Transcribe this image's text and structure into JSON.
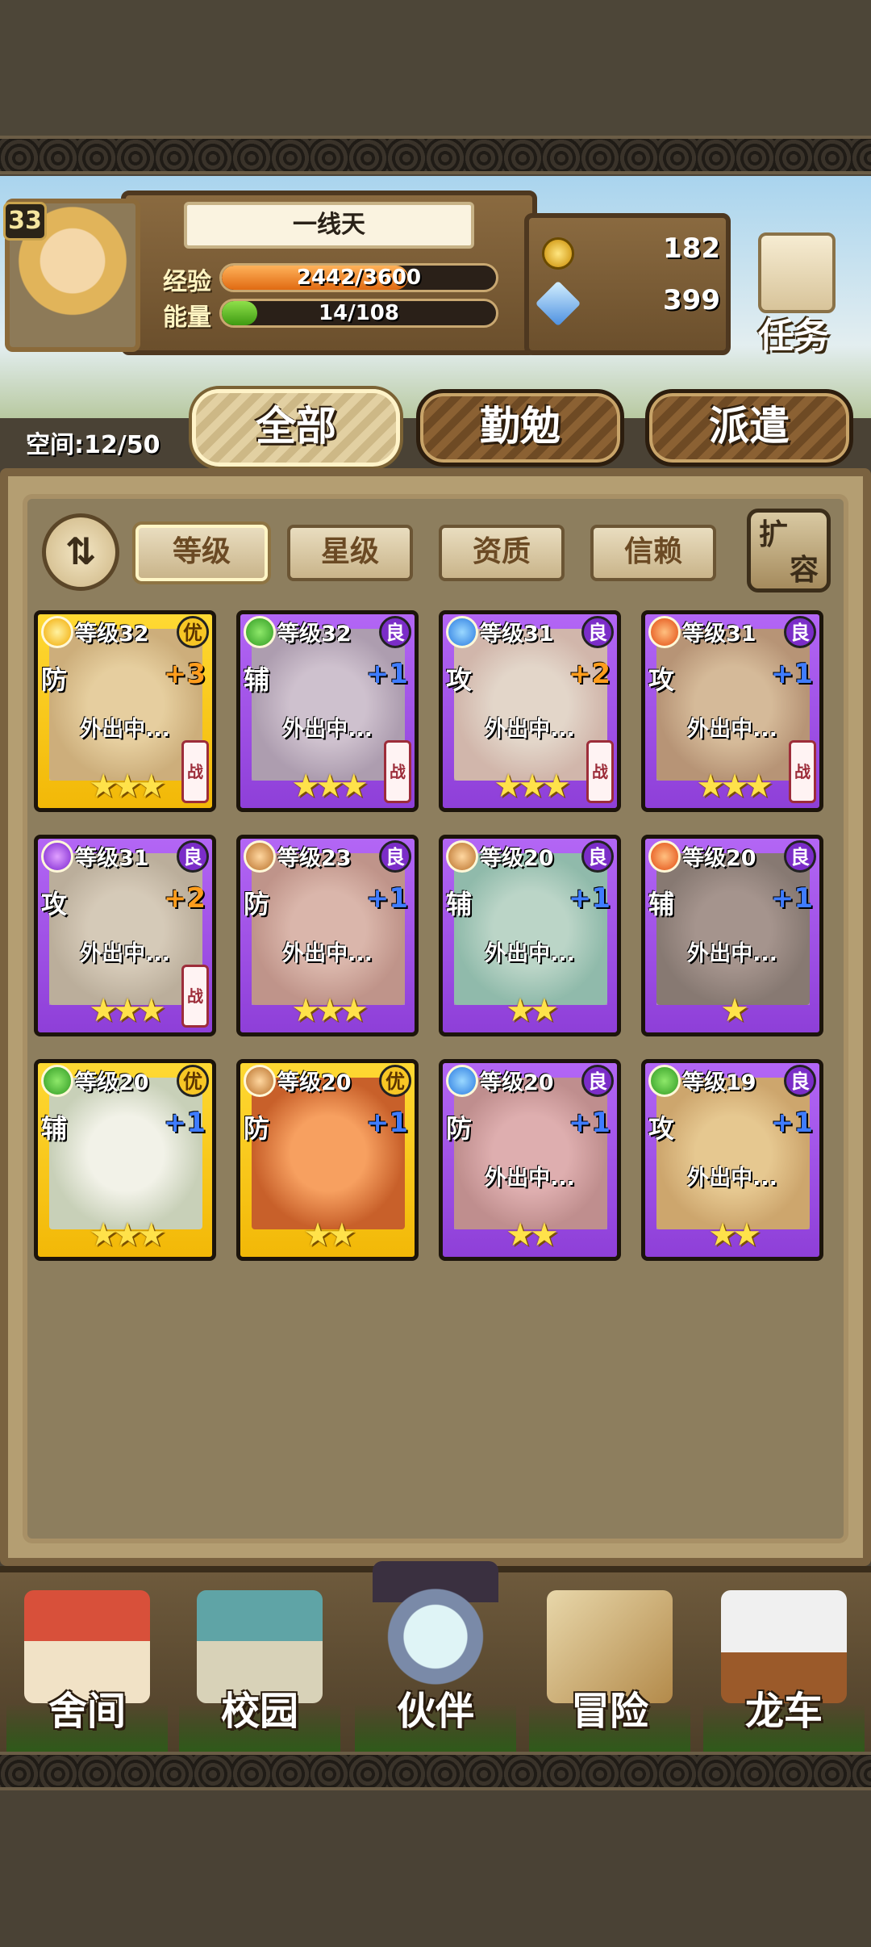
{
  "player": {
    "level": "33",
    "name": "一线天",
    "exp_label": "经验",
    "exp_text": "2442/3600",
    "exp_fraction": 0.678,
    "energy_label": "能量",
    "energy_text": "14/108",
    "energy_fraction": 0.13,
    "gold": "182",
    "gems": "399"
  },
  "task_label": "任务",
  "space_text": "空间:12/50",
  "tabs": {
    "all": "全部",
    "diligent": "勤勉",
    "dispatch": "派遣"
  },
  "filters": {
    "level": "等级",
    "star": "星级",
    "quality": "资质",
    "trust": "信赖"
  },
  "expand_label_1": "扩",
  "expand_label_2": "容",
  "sort_symbol": "⇅",
  "heroes": [
    {
      "level": "等级32",
      "quality": "优",
      "role": "防",
      "plus": "+3",
      "away": "外出中...",
      "stars": "★★★",
      "battle": "战",
      "element": "light"
    },
    {
      "level": "等级32",
      "quality": "良",
      "role": "辅",
      "plus": "+1",
      "away": "外出中...",
      "stars": "★★★",
      "battle": "战",
      "element": "wood"
    },
    {
      "level": "等级31",
      "quality": "良",
      "role": "攻",
      "plus": "+2",
      "away": "外出中...",
      "stars": "★★★",
      "battle": "战",
      "element": "water"
    },
    {
      "level": "等级31",
      "quality": "良",
      "role": "攻",
      "plus": "+1",
      "away": "外出中...",
      "stars": "★★★",
      "battle": "战",
      "element": "fire"
    },
    {
      "level": "等级31",
      "quality": "良",
      "role": "攻",
      "plus": "+2",
      "away": "外出中...",
      "stars": "★★★",
      "battle": "战",
      "element": "dark"
    },
    {
      "level": "等级23",
      "quality": "良",
      "role": "防",
      "plus": "+1",
      "away": "外出中...",
      "stars": "★★★",
      "battle": "",
      "element": "earth"
    },
    {
      "level": "等级20",
      "quality": "良",
      "role": "辅",
      "plus": "+1",
      "away": "外出中...",
      "stars": "★★",
      "battle": "",
      "element": "earth"
    },
    {
      "level": "等级20",
      "quality": "良",
      "role": "辅",
      "plus": "+1",
      "away": "外出中...",
      "stars": "★",
      "battle": "",
      "element": "fire"
    },
    {
      "level": "等级20",
      "quality": "优",
      "role": "辅",
      "plus": "+1",
      "away": "",
      "stars": "★★★",
      "battle": "",
      "element": "wood"
    },
    {
      "level": "等级20",
      "quality": "优",
      "role": "防",
      "plus": "+1",
      "away": "",
      "stars": "★★",
      "battle": "",
      "element": "earth"
    },
    {
      "level": "等级20",
      "quality": "良",
      "role": "防",
      "plus": "+1",
      "away": "外出中...",
      "stars": "★★",
      "battle": "",
      "element": "water"
    },
    {
      "level": "等级19",
      "quality": "良",
      "role": "攻",
      "plus": "+1",
      "away": "外出中...",
      "stars": "★★",
      "battle": "",
      "element": "wood"
    }
  ],
  "nav": {
    "dorm": "舍间",
    "campus": "校园",
    "partner": "伙伴",
    "adventure": "冒险",
    "carriage": "龙车"
  }
}
